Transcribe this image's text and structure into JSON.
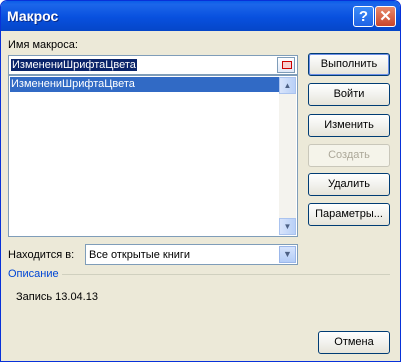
{
  "window": {
    "title": "Макрос",
    "help_symbol": "?",
    "close_symbol": "✕"
  },
  "macro_name": {
    "label": "Имя макроса:",
    "value": "ИзменениШрифтаЦвета",
    "edit_icon": "edit-reference-icon"
  },
  "macro_list": {
    "items": [
      "ИзменениШрифтаЦвета"
    ],
    "selected_index": 0
  },
  "buttons": {
    "run": "Выполнить",
    "step_into": "Войти",
    "edit": "Изменить",
    "create": "Создать",
    "delete": "Удалить",
    "options": "Параметры...",
    "cancel": "Отмена"
  },
  "location": {
    "label": "Находится в:",
    "value": "Все открытые книги"
  },
  "description": {
    "label": "Описание",
    "text": "Запись 13.04.13"
  }
}
